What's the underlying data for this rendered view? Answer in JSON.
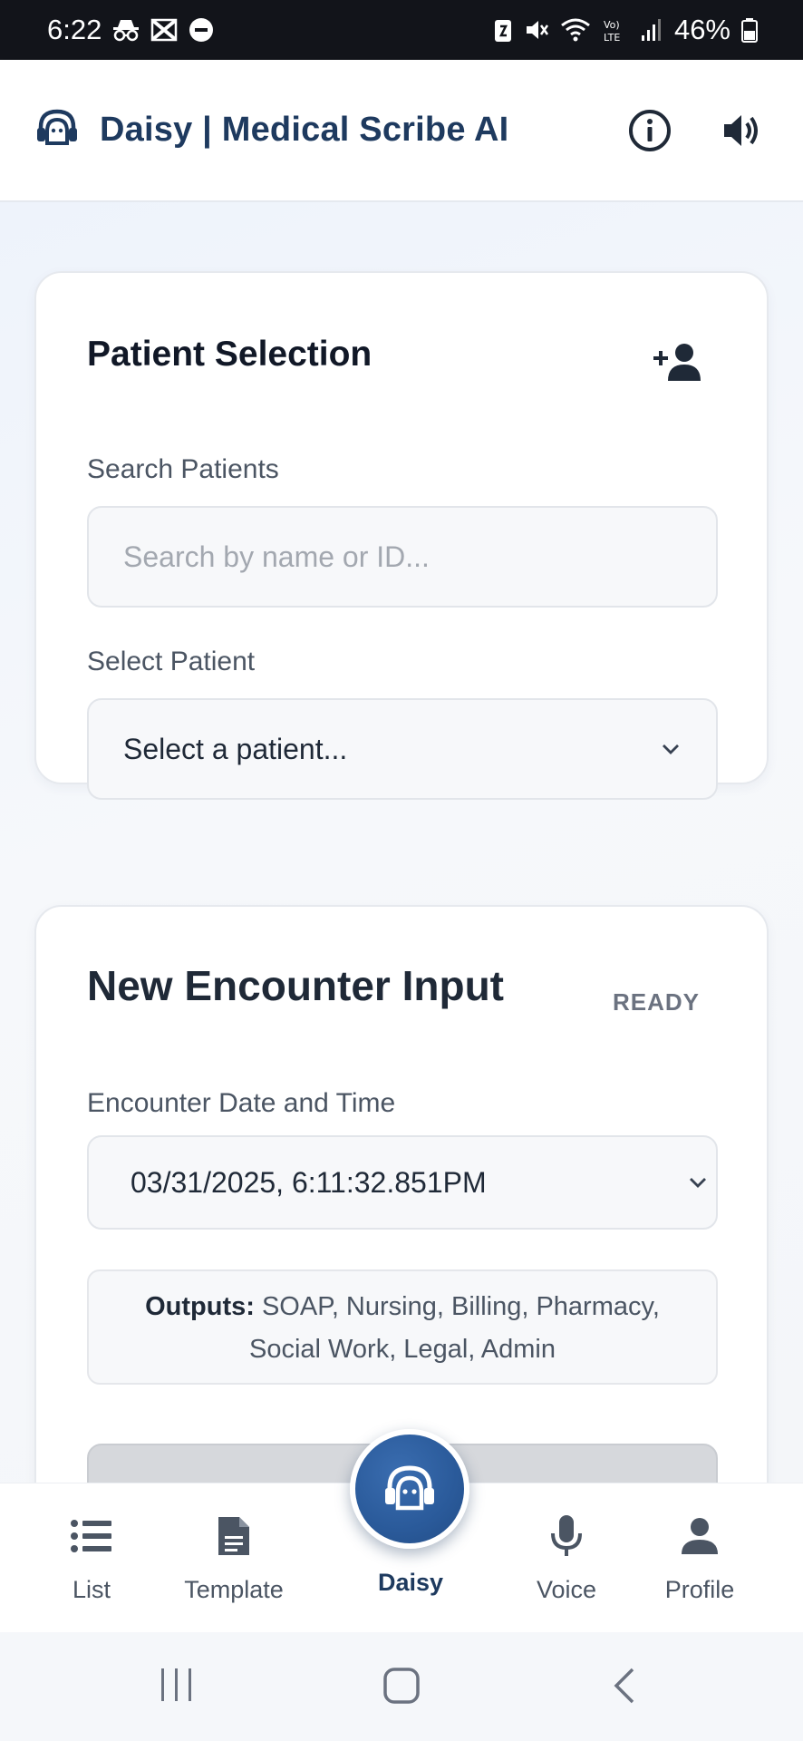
{
  "status_bar": {
    "time": "6:22",
    "battery": "46%"
  },
  "header": {
    "title": "Daisy | Medical Scribe AI",
    "brand_color": "#1e3a5f"
  },
  "patient_selection": {
    "title": "Patient Selection",
    "search_label": "Search Patients",
    "search_placeholder": "Search by name or ID...",
    "select_label": "Select Patient",
    "select_value": "Select a patient..."
  },
  "encounter": {
    "title": "New Encounter Input",
    "status": "READY",
    "date_label": "Encounter Date and Time",
    "date_value": "03/31/2025, 6:11:32.851PM",
    "outputs_label": "Outputs:",
    "outputs_value": "SOAP, Nursing, Billing, Pharmacy, Social Work, Legal, Admin"
  },
  "bottom_nav": {
    "items": [
      {
        "label": "List",
        "icon": "list-icon"
      },
      {
        "label": "Template",
        "icon": "document-icon"
      },
      {
        "label": "Daisy",
        "icon": "headset-agent-icon"
      },
      {
        "label": "Voice",
        "icon": "microphone-icon"
      },
      {
        "label": "Profile",
        "icon": "person-icon"
      }
    ]
  }
}
